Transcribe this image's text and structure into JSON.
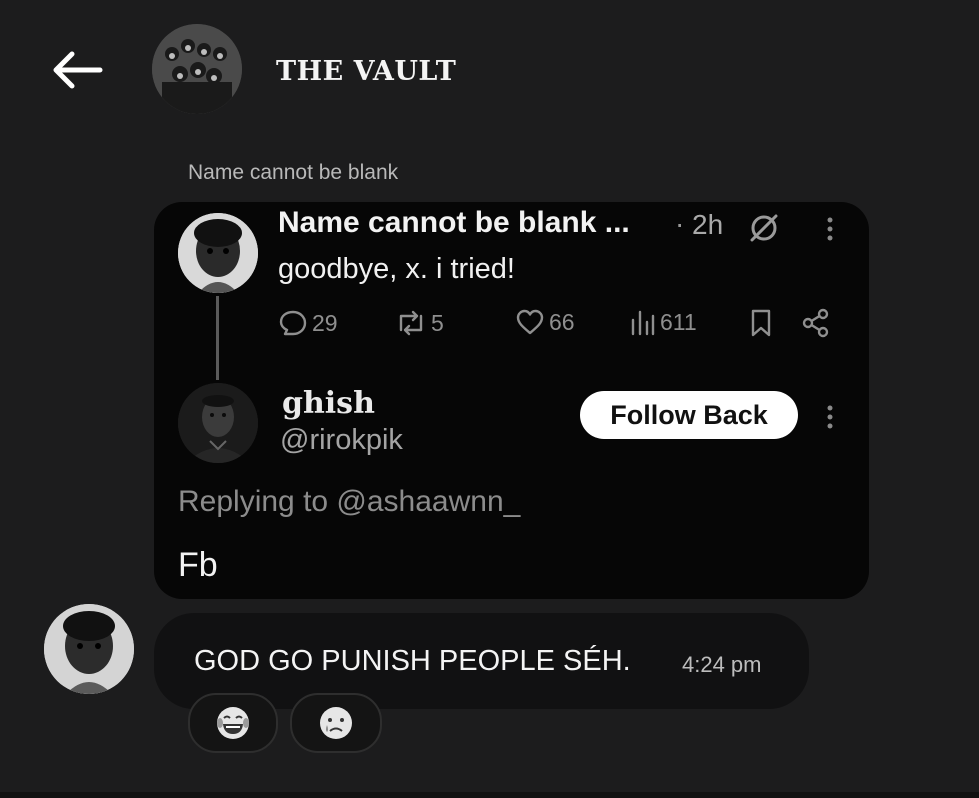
{
  "header": {
    "title": "THE VAULT",
    "back_icon": "arrow-left-icon"
  },
  "shared_post": {
    "sender_label": "Name cannot be blank",
    "tweet": {
      "author_name": "Name cannot be blank ...",
      "dot": "·",
      "time": "2h",
      "text": "goodbye, x. i tried!",
      "stats": {
        "replies": "29",
        "reposts": "5",
        "likes": "66",
        "views": "611"
      }
    },
    "reply": {
      "display_name": "ghish",
      "handle": "@rirokpik",
      "follow_label": "Follow Back",
      "replying_to": "Replying to @ashaawnn_",
      "text": "Fb"
    }
  },
  "message": {
    "text": "GOD GO PUNISH PEOPLE SÉH.",
    "time": "4:24 pm",
    "reactions": [
      "😂",
      "😢"
    ]
  },
  "colors": {
    "background": "#1c1c1d",
    "card": "#060606",
    "bubble": "#111112",
    "follow_button": "#ffffff"
  }
}
